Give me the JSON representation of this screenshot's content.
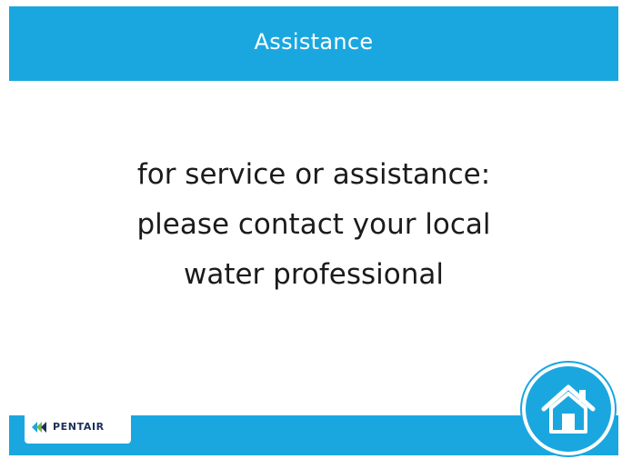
{
  "header": {
    "title": "Assistance"
  },
  "message": {
    "lines": [
      "for service or assistance:",
      "please contact your local",
      "water professional"
    ]
  },
  "footer": {
    "logo_text": "PENTAIR",
    "home_button_icon": "home-icon"
  },
  "colors": {
    "accent": "#1aa7e0",
    "text": "#1b1b1b",
    "logo_navy": "#1c2f5a",
    "logo_green": "#7ab648"
  }
}
